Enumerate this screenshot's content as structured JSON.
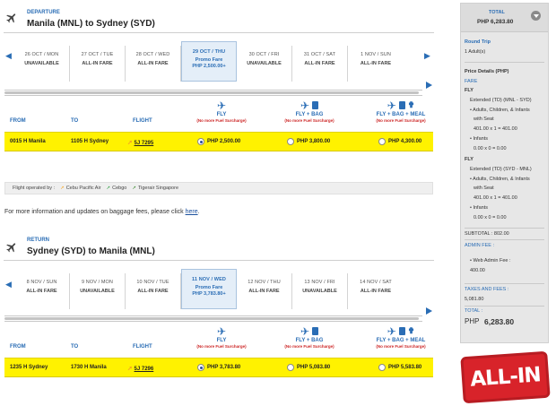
{
  "departure": {
    "section_label": "DEPARTURE",
    "route": "Manila  (MNL) to Sydney  (SYD)",
    "dates": [
      {
        "date": "26 OCT / MON",
        "status": "UNAVAILABLE",
        "selected": false
      },
      {
        "date": "27 OCT / TUE",
        "status": "ALL-IN FARE",
        "selected": false
      },
      {
        "date": "28 OCT / WED",
        "status": "ALL-IN FARE",
        "selected": false
      },
      {
        "date": "29 OCT / THU",
        "status": "Promo Fare",
        "price": "PHP 2,500.00+",
        "selected": true
      },
      {
        "date": "30 OCT / FRI",
        "status": "UNAVAILABLE",
        "selected": false
      },
      {
        "date": "31 OCT / SAT",
        "status": "ALL-IN FARE",
        "selected": false
      },
      {
        "date": "1 NOV / SUN",
        "status": "ALL-IN FARE",
        "selected": false
      }
    ],
    "columns": {
      "from": "FROM",
      "to": "TO",
      "flight": "FLIGHT"
    },
    "fares": [
      {
        "name": "FLY",
        "note": "(No more Fuel Surcharge)"
      },
      {
        "name": "FLY + BAG",
        "note": "(No more Fuel Surcharge)"
      },
      {
        "name": "FLY + BAG + MEAL",
        "note": "(No more Fuel Surcharge)"
      }
    ],
    "flight": {
      "depart": "0015 H  Manila",
      "arrive": "1105 H  Sydney",
      "flight_no": "5J  7295",
      "prices": [
        "PHP 2,500.00",
        "PHP 3,800.00",
        "PHP 4,300.00"
      ],
      "selected_fare": 0
    }
  },
  "operated_by": {
    "label": "Flight operated by :",
    "carriers": [
      "Cebu Pacific Air",
      "Cebgo",
      "Tigerair Singapore"
    ],
    "colors": [
      "#f5a623",
      "#2a9d3f",
      "#3b8a2e"
    ]
  },
  "baggage_info": {
    "text": "For more information and updates on baggage fees, please click ",
    "link": "here",
    "end": "."
  },
  "return": {
    "section_label": "RETURN",
    "route": "Sydney  (SYD) to Manila  (MNL)",
    "dates": [
      {
        "date": "8 NOV / SUN",
        "status": "ALL-IN FARE",
        "selected": false
      },
      {
        "date": "9 NOV / MON",
        "status": "UNAVAILABLE",
        "selected": false
      },
      {
        "date": "10 NOV / TUE",
        "status": "ALL-IN FARE",
        "selected": false
      },
      {
        "date": "11 NOV / WED",
        "status": "Promo Fare",
        "price": "PHP 3,783.80+",
        "selected": true
      },
      {
        "date": "12 NOV / THU",
        "status": "ALL-IN FARE",
        "selected": false
      },
      {
        "date": "13 NOV / FRI",
        "status": "UNAVAILABLE",
        "selected": false
      },
      {
        "date": "14 NOV / SAT",
        "status": "ALL-IN FARE",
        "selected": false
      }
    ],
    "columns": {
      "from": "FROM",
      "to": "TO",
      "flight": "FLIGHT"
    },
    "fares": [
      {
        "name": "FLY",
        "note": "(No more Fuel Surcharge)"
      },
      {
        "name": "FLY + BAG",
        "note": "(No more Fuel Surcharge)"
      },
      {
        "name": "FLY + BAG + MEAL",
        "note": "(No more Fuel Surcharge)"
      }
    ],
    "flight": {
      "depart": "1235 H  Sydney",
      "arrive": "1730 H  Manila",
      "flight_no": "5J  7296",
      "prices": [
        "PHP 3,783.80",
        "PHP 5,083.80",
        "PHP 5,583.80"
      ],
      "selected_fare": 0
    }
  },
  "sidebar": {
    "total_label": "TOTAL",
    "total_value": "PHP  6,283.80",
    "trip_type": "Round Trip",
    "pax": "1  Adult(s)",
    "price_details": "Price Details (PHP)",
    "fare_label": "FARE",
    "fly_label_1": "FLY",
    "leg1": "Extended (TD) (MNL - SYD)",
    "leg1_pax_1": "• Adults, Children, & Infants",
    "leg1_pax_2": "with Seat",
    "leg1_calc": "401.00 x 1 = 401.00",
    "leg1_inf": "• Infants",
    "leg1_inf_calc": "0.00 x 0 = 0.00",
    "fly_label_2": "FLY",
    "leg2": "Extended (TD) (SYD - MNL)",
    "leg2_pax_1": "• Adults, Children, & Infants",
    "leg2_pax_2": "with Seat",
    "leg2_calc": "401.00 x 1 = 401.00",
    "leg2_inf": "• Infants",
    "leg2_inf_calc": "0.00 x 0 = 0.00",
    "subtotal": "SUBTOTAL : 802.00",
    "admin_label": "ADMIN FEE :",
    "admin_item": "• Web Admin Fee :",
    "admin_value": "400.00",
    "taxes_label": "TAXES AND FEES :",
    "taxes_value": "5,081.80",
    "grand_label": "TOTAL :",
    "grand_currency": "PHP",
    "grand_value": "6,283.80"
  },
  "badge": {
    "text": "ALL-IN"
  }
}
